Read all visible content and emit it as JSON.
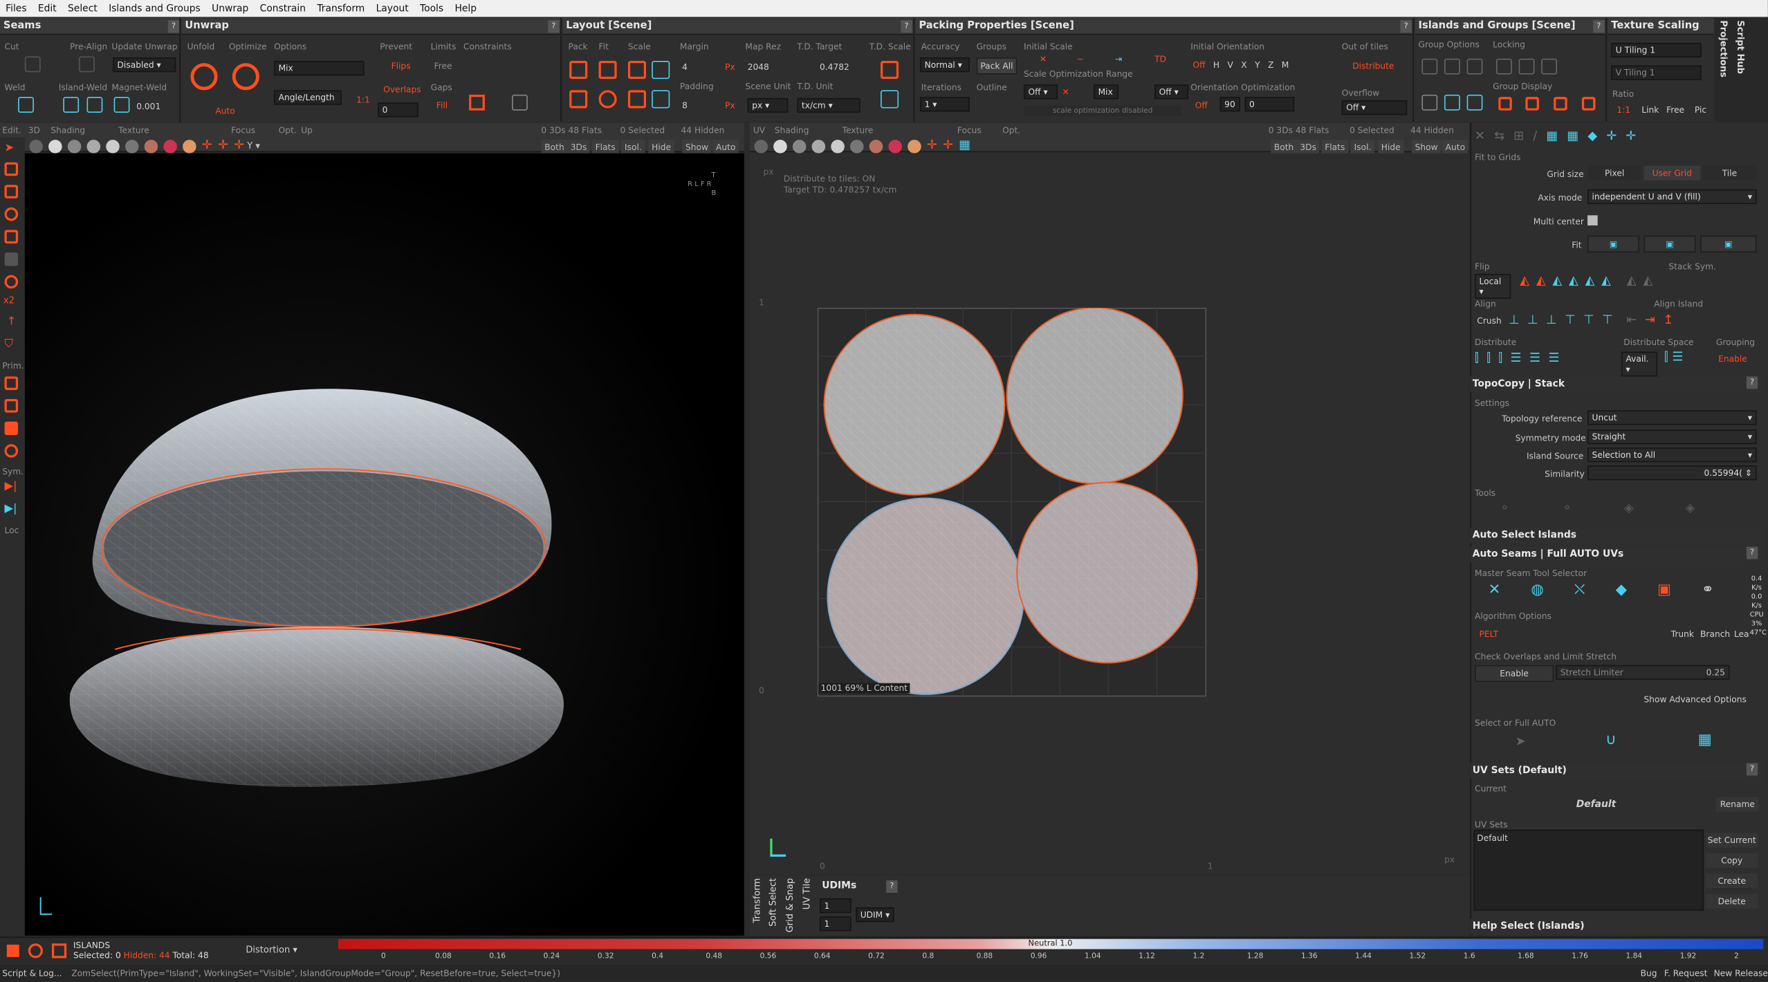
{
  "menu": [
    "Files",
    "Edit",
    "Select",
    "Islands and Groups",
    "Unwrap",
    "Constrain",
    "Transform",
    "Layout",
    "Tools",
    "Help"
  ],
  "panels": {
    "seams": {
      "title": "Seams",
      "cut": "Cut",
      "pre_align": "Pre-Align",
      "update_unwrap": "Update Unwrap",
      "update_value": "Disabled",
      "weld": "Weld",
      "island_weld": "Island-Weld",
      "magnet_weld": "Magnet-Weld",
      "magnet_value": "0.001"
    },
    "unwrap": {
      "title": "Unwrap",
      "unfold": "Unfold",
      "optimize": "Optimize",
      "options": "Options",
      "options_value": "Mix",
      "angle_length": "Angle/Length",
      "ratio": "1:1",
      "auto": "Auto",
      "prevent": "Prevent",
      "flips": "Flips",
      "overlaps": "Overlaps",
      "limits": "Limits",
      "free": "Free",
      "gaps": "Gaps",
      "fill": "Fill",
      "gaps_value": "0",
      "constraints": "Constraints"
    },
    "layout": {
      "title": "Layout [Scene]",
      "pack": "Pack",
      "fit": "Fit",
      "scale": "Scale",
      "margin": "Margin",
      "margin_value": "4",
      "padding": "Padding",
      "padding_value": "8",
      "px": "Px",
      "map_rez": "Map Rez",
      "map_rez_value": "2048",
      "scene_unit": "Scene Unit",
      "scene_unit_value": "px",
      "td_target": "T.D. Target",
      "td_target_value": "0.4782",
      "td_unit": "T.D. Unit",
      "td_unit_value": "tx/cm",
      "td_scale": "T.D. Scale"
    },
    "packing": {
      "title": "Packing Properties [Scene]",
      "accuracy": "Accuracy",
      "accuracy_value": "Normal",
      "groups": "Groups",
      "pack_all": "Pack All",
      "iterations": "Iterations",
      "iterations_value": "1",
      "outline": "Outline",
      "initial_scale": "Initial Scale",
      "scale_opt_range": "Scale Optimization Range",
      "scale_off": "Off",
      "mix": "Mix",
      "scale_opt_disabled": "scale optimization disabled",
      "initial_orientation": "Initial Orientation",
      "orient_off": "Off",
      "axes": [
        "H",
        "V",
        "X",
        "Y",
        "Z",
        "M"
      ],
      "orientation_opt": "Orientation Optimization",
      "orient_opt_off": "Off",
      "orient_angle": "90",
      "orient_value": "0",
      "out_of_tiles": "Out of tiles",
      "distribute": "Distribute",
      "overflow": "Overflow",
      "overflow_value": "Off"
    },
    "islands_groups": {
      "title": "Islands and Groups [Scene]",
      "group_options": "Group Options",
      "locking": "Locking",
      "group_display": "Group Display"
    },
    "texture_scaling": {
      "title": "Texture Scaling",
      "u_tiling": "U Tiling",
      "u_value": "1",
      "v_tiling": "V Tiling",
      "v_value": "1",
      "ratio": "Ratio",
      "ratio_value": "1:1",
      "link": "Link",
      "free": "Free",
      "pic": "Pic"
    },
    "side_tabs": [
      "Script Hub",
      "Projections"
    ]
  },
  "view3d": {
    "edit": "Edit.",
    "mode": "3D",
    "shading": "Shading",
    "texture": "Texture",
    "focus": "Focus",
    "opt": "Opt.",
    "up": "Up",
    "axis": "Y",
    "stats": "0 3Ds 48 Flats",
    "selected": "0 Selected",
    "hidden": "44 Hidden",
    "filters": [
      "Both",
      "3Ds",
      "Flats",
      "Isol.",
      "Hide",
      "Show",
      "Auto"
    ],
    "side_labels": [
      "Prim.",
      "Sym.",
      "Loc"
    ],
    "nav_cube": [
      "T",
      "R",
      "L",
      "F",
      "R",
      "B"
    ]
  },
  "viewuv": {
    "mode": "UV",
    "shading": "Shading",
    "texture": "Texture",
    "focus": "Focus",
    "opt": "Opt.",
    "stats": "0 3Ds 48 Flats",
    "selected": "0 Selected",
    "hidden": "44 Hidden",
    "filters": [
      "Both",
      "3Ds",
      "Flats",
      "Isol.",
      "Hide",
      "Show",
      "Auto"
    ],
    "info1": "Distribute to tiles: ON",
    "info2": "Target TD: 0.478257 tx/cm",
    "tile_id": "1001",
    "tile_pct": "69%",
    "tile_content": "L Content",
    "px_tl": "px",
    "px_br": "px",
    "axis_1": "1",
    "axis_0": "0",
    "axis_x0": "0",
    "axis_x1": "1"
  },
  "uv_bottom": {
    "tabs": [
      "Transform",
      "Soft Select",
      "Grid & Snap",
      "UV Tile"
    ],
    "udims_title": "UDIMs",
    "udim_a": "1",
    "udim_b": "1",
    "udim_mode": "UDIM"
  },
  "right": {
    "fit_to_grids": "Fit to Grids",
    "grid_size": "Grid size",
    "grid_opts": [
      "Pixel",
      "User Grid",
      "Tile"
    ],
    "axis_mode": "Axis mode",
    "axis_mode_value": "independent U and V (fill)",
    "multi_center": "Multi center",
    "fit": "Fit",
    "flip": "Flip",
    "flip_mode": "Local",
    "stack_sym": "Stack Sym.",
    "align": "Align",
    "crush": "Crush",
    "align_island": "Align Island",
    "distribute": "Distribute",
    "distribute_space": "Distribute Space",
    "avail": "Avail.",
    "grouping": "Grouping",
    "enable": "Enable",
    "topocopy_title": "TopoCopy | Stack",
    "settings": "Settings",
    "topology_reference": "Topology reference",
    "topology_value": "Uncut",
    "symmetry_mode": "Symmetry mode",
    "symmetry_value": "Straight",
    "island_source": "Island Source",
    "island_source_value": "Selection to All",
    "similarity": "Similarity",
    "similarity_value": "0.55994(",
    "tools": "Tools",
    "auto_select_title": "Auto Select Islands",
    "auto_seams_title": "Auto Seams | Full AUTO UVs",
    "master_seam": "Master Seam Tool Selector",
    "algorithm_options": "Algorithm Options",
    "pelt": "PELT",
    "trunk": "Trunk",
    "branch": "Branch",
    "leaf": "Lea",
    "check_overlaps": "Check Overlaps and Limit Stretch",
    "enable_btn": "Enable",
    "stretch_limiter": "Stretch Limiter",
    "stretch_value": "0.25",
    "show_advanced": "Show Advanced Options",
    "select_full_auto": "Select or Full AUTO",
    "uv_sets_title": "UV Sets (Default)",
    "current": "Current",
    "current_value": "Default",
    "rename": "Rename",
    "uv_sets": "UV Sets",
    "uv_set_item": "Default",
    "set_current": "Set Current",
    "copy": "Copy",
    "create": "Create",
    "delete": "Delete",
    "help_select": "Help Select (Islands)",
    "perf": [
      "0.4",
      "K/s",
      "0.0",
      "K/s",
      "CPU",
      "3%",
      "47°C"
    ]
  },
  "bottom": {
    "islands": "ISLANDS",
    "selected": "Selected: 0",
    "hidden": "Hidden: 44",
    "total": "Total: 48",
    "distortion": "Distortion",
    "neutral": "Neutral 1.0",
    "ticks": [
      "0",
      "0.08",
      "0.16",
      "0.24",
      "0.32",
      "0.4",
      "0.48",
      "0.56",
      "0.64",
      "0.72",
      "0.8",
      "0.88",
      "0.96",
      "1.04",
      "1.12",
      "1.2",
      "1.28",
      "1.36",
      "1.44",
      "1.52",
      "1.6",
      "1.68",
      "1.76",
      "1.84",
      "1.92",
      "2"
    ]
  },
  "status": {
    "script_log": "Script & Log...",
    "command": "ZomSelect(PrimType=\"Island\", WorkingSet=\"Visible\", IslandGroupMode=\"Group\", ResetBefore=true, Select=true})",
    "bug": "Bug",
    "feature": "F. Request",
    "release": "New Release"
  },
  "colors": {
    "accent": "#ff4e1f",
    "cyan": "#48d2f0",
    "bg": "#2b2b2b"
  }
}
